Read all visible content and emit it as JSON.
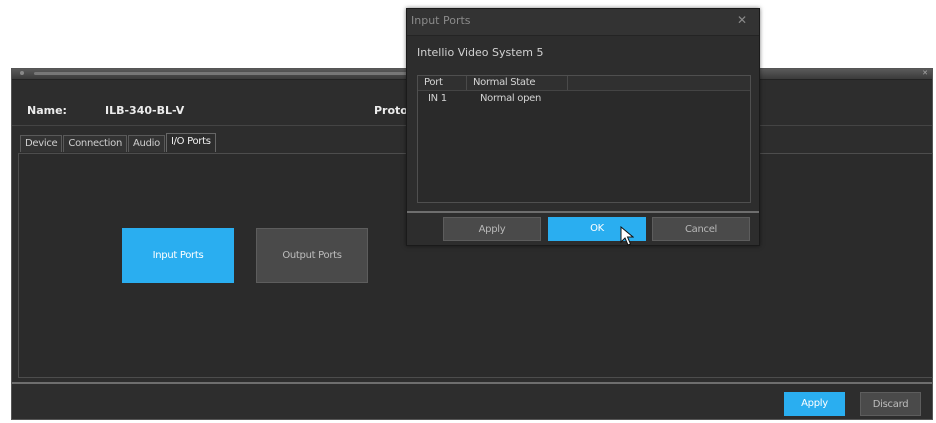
{
  "main": {
    "name_label": "Name:",
    "name_value": "ILB-340-BL-V",
    "protocol_label": "Proto",
    "tabs": [
      {
        "label": "Device"
      },
      {
        "label": "Connection"
      },
      {
        "label": "Audio"
      },
      {
        "label": "I/O Ports"
      }
    ],
    "active_tab": "I/O Ports",
    "input_ports_label": "Input Ports",
    "output_ports_label": "Output Ports",
    "footer": {
      "apply_label": "Apply",
      "discard_label": "Discard"
    }
  },
  "dialog": {
    "title": "Input Ports",
    "close_icon": "close-icon",
    "subtitle": "Intellio Video System 5",
    "table": {
      "columns": [
        "Port",
        "Normal State"
      ],
      "rows": [
        {
          "port": "IN 1",
          "state": "Normal open"
        }
      ]
    },
    "buttons": {
      "apply": "Apply",
      "ok": "OK",
      "cancel": "Cancel"
    }
  },
  "colors": {
    "accent": "#2aaef0",
    "background": "#2d2d2d",
    "button_secondary": "#4a4a4a"
  }
}
